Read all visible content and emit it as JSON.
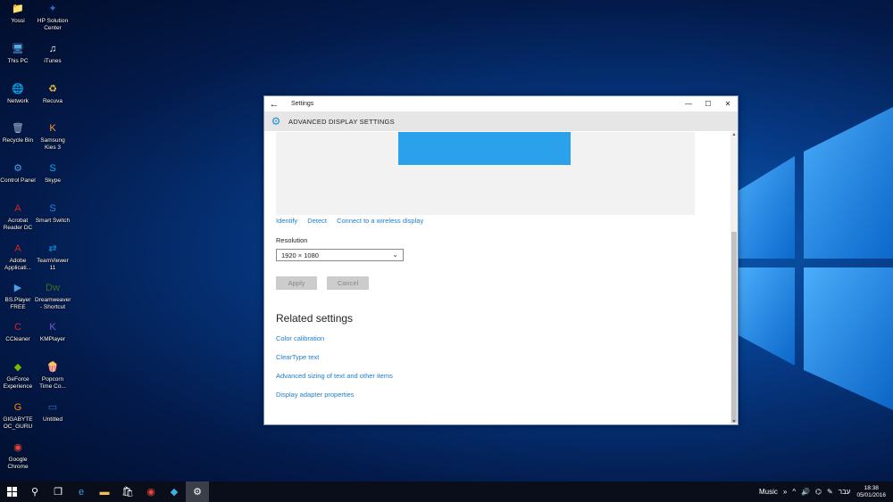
{
  "desktop": {
    "icons": [
      {
        "label": "Yossi",
        "icon": "folder-user-icon",
        "color": "#e8c35a",
        "glyph": "📁"
      },
      {
        "label": "HP Solution Center",
        "icon": "hp-icon",
        "color": "#2a6bd1",
        "glyph": "✦"
      },
      {
        "label": "This PC",
        "icon": "computer-icon",
        "color": "#5aa9e6",
        "glyph": "🖥"
      },
      {
        "label": "iTunes",
        "icon": "itunes-icon",
        "color": "#ffffff",
        "glyph": "♫"
      },
      {
        "label": "Network",
        "icon": "network-icon",
        "color": "#3a8fd9",
        "glyph": "🌐"
      },
      {
        "label": "Recuva",
        "icon": "recuva-icon",
        "color": "#f0c040",
        "glyph": "♻"
      },
      {
        "label": "Recycle Bin",
        "icon": "recycle-bin-icon",
        "color": "#9fb8d0",
        "glyph": "🗑"
      },
      {
        "label": "Samsung Kies 3",
        "icon": "kies-icon",
        "color": "#f29a2e",
        "glyph": "K"
      },
      {
        "label": "Control Panel",
        "icon": "control-panel-icon",
        "color": "#4aa0e0",
        "glyph": "⚙"
      },
      {
        "label": "Skype",
        "icon": "skype-icon",
        "color": "#00aff0",
        "glyph": "S"
      },
      {
        "label": "Acrobat Reader DC",
        "icon": "acrobat-icon",
        "color": "#d9231c",
        "glyph": "A"
      },
      {
        "label": "Smart Switch",
        "icon": "smart-switch-icon",
        "color": "#1a8be0",
        "glyph": "S"
      },
      {
        "label": "Adobe Applicati...",
        "icon": "adobe-icon",
        "color": "#d9231c",
        "glyph": "A"
      },
      {
        "label": "TeamViewer 11",
        "icon": "teamviewer-icon",
        "color": "#0e8ee9",
        "glyph": "⇄"
      },
      {
        "label": "BS.Player FREE",
        "icon": "bsplayer-icon",
        "color": "#4aa0e0",
        "glyph": "▶"
      },
      {
        "label": "Dreamweaver - Shortcut",
        "icon": "dreamweaver-icon",
        "color": "#3a6e1f",
        "glyph": "Dw"
      },
      {
        "label": "CCleaner",
        "icon": "ccleaner-icon",
        "color": "#d9231c",
        "glyph": "C"
      },
      {
        "label": "KMPlayer",
        "icon": "kmplayer-icon",
        "color": "#7b5bd6",
        "glyph": "K"
      },
      {
        "label": "GeForce Experience",
        "icon": "geforce-icon",
        "color": "#76b900",
        "glyph": "◆"
      },
      {
        "label": "Popcorn Time Co...",
        "icon": "popcorn-icon",
        "color": "#e04040",
        "glyph": "🍿"
      },
      {
        "label": "GIGABYTE OC_GURU",
        "icon": "gigabyte-icon",
        "color": "#ff8a00",
        "glyph": "G"
      },
      {
        "label": "Untitled",
        "icon": "video-file-icon",
        "color": "#2a70d0",
        "glyph": "▭"
      },
      {
        "label": "Google Chrome",
        "icon": "chrome-icon",
        "color": "#e8453c",
        "glyph": "◉"
      }
    ]
  },
  "window": {
    "title": "Settings",
    "back_glyph": "←",
    "minimize_glyph": "—",
    "maximize_glyph": "☐",
    "close_glyph": "✕",
    "header_title": "ADVANCED DISPLAY SETTINGS",
    "links": {
      "identify": "Identify",
      "detect": "Detect",
      "wireless": "Connect to a wireless display"
    },
    "resolution_label": "Resolution",
    "resolution_value": "1920 × 1080",
    "apply_label": "Apply",
    "cancel_label": "Cancel",
    "related_title": "Related settings",
    "related_links": [
      "Color calibration",
      "ClearType text",
      "Advanced sizing of text and other items",
      "Display adapter properties"
    ],
    "accent": "#1e7ccc",
    "monitor_color": "#2aa1ea"
  },
  "taskbar": {
    "tray_music": "Music",
    "tray_arrows": "»",
    "language": "עבר",
    "time": "18:38",
    "date": "05/01/2016"
  }
}
